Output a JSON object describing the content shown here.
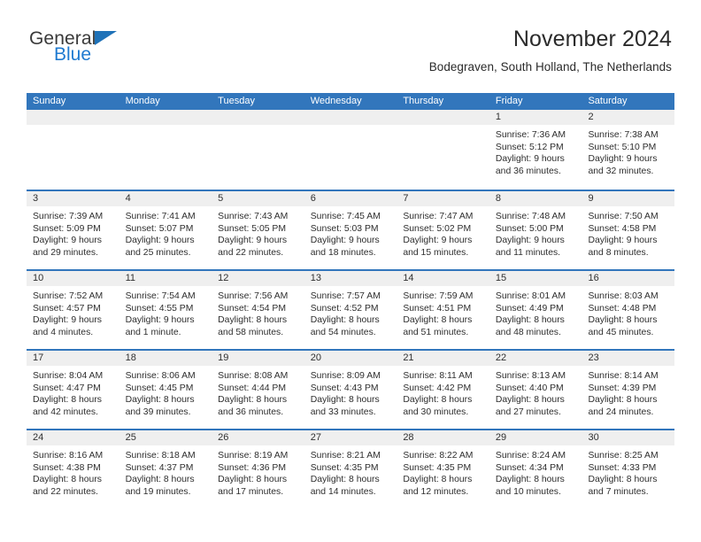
{
  "brand": {
    "name_part1": "General",
    "name_part2": "Blue",
    "triangle_color": "#1f72b8",
    "blue_color": "#1f7ad0"
  },
  "header": {
    "title": "November 2024",
    "subtitle": "Bodegraven, South Holland, The Netherlands"
  },
  "theme": {
    "header_blue": "#3276bc",
    "daynum_band": "#efefef",
    "text": "#2e2e2e"
  },
  "weekdays": [
    "Sunday",
    "Monday",
    "Tuesday",
    "Wednesday",
    "Thursday",
    "Friday",
    "Saturday"
  ],
  "weeks": [
    [
      {
        "day": "",
        "info": ""
      },
      {
        "day": "",
        "info": ""
      },
      {
        "day": "",
        "info": ""
      },
      {
        "day": "",
        "info": ""
      },
      {
        "day": "",
        "info": ""
      },
      {
        "day": "1",
        "info": "Sunrise: 7:36 AM\nSunset: 5:12 PM\nDaylight: 9 hours\nand 36 minutes."
      },
      {
        "day": "2",
        "info": "Sunrise: 7:38 AM\nSunset: 5:10 PM\nDaylight: 9 hours\nand 32 minutes."
      }
    ],
    [
      {
        "day": "3",
        "info": "Sunrise: 7:39 AM\nSunset: 5:09 PM\nDaylight: 9 hours\nand 29 minutes."
      },
      {
        "day": "4",
        "info": "Sunrise: 7:41 AM\nSunset: 5:07 PM\nDaylight: 9 hours\nand 25 minutes."
      },
      {
        "day": "5",
        "info": "Sunrise: 7:43 AM\nSunset: 5:05 PM\nDaylight: 9 hours\nand 22 minutes."
      },
      {
        "day": "6",
        "info": "Sunrise: 7:45 AM\nSunset: 5:03 PM\nDaylight: 9 hours\nand 18 minutes."
      },
      {
        "day": "7",
        "info": "Sunrise: 7:47 AM\nSunset: 5:02 PM\nDaylight: 9 hours\nand 15 minutes."
      },
      {
        "day": "8",
        "info": "Sunrise: 7:48 AM\nSunset: 5:00 PM\nDaylight: 9 hours\nand 11 minutes."
      },
      {
        "day": "9",
        "info": "Sunrise: 7:50 AM\nSunset: 4:58 PM\nDaylight: 9 hours\nand 8 minutes."
      }
    ],
    [
      {
        "day": "10",
        "info": "Sunrise: 7:52 AM\nSunset: 4:57 PM\nDaylight: 9 hours\nand 4 minutes."
      },
      {
        "day": "11",
        "info": "Sunrise: 7:54 AM\nSunset: 4:55 PM\nDaylight: 9 hours\nand 1 minute."
      },
      {
        "day": "12",
        "info": "Sunrise: 7:56 AM\nSunset: 4:54 PM\nDaylight: 8 hours\nand 58 minutes."
      },
      {
        "day": "13",
        "info": "Sunrise: 7:57 AM\nSunset: 4:52 PM\nDaylight: 8 hours\nand 54 minutes."
      },
      {
        "day": "14",
        "info": "Sunrise: 7:59 AM\nSunset: 4:51 PM\nDaylight: 8 hours\nand 51 minutes."
      },
      {
        "day": "15",
        "info": "Sunrise: 8:01 AM\nSunset: 4:49 PM\nDaylight: 8 hours\nand 48 minutes."
      },
      {
        "day": "16",
        "info": "Sunrise: 8:03 AM\nSunset: 4:48 PM\nDaylight: 8 hours\nand 45 minutes."
      }
    ],
    [
      {
        "day": "17",
        "info": "Sunrise: 8:04 AM\nSunset: 4:47 PM\nDaylight: 8 hours\nand 42 minutes."
      },
      {
        "day": "18",
        "info": "Sunrise: 8:06 AM\nSunset: 4:45 PM\nDaylight: 8 hours\nand 39 minutes."
      },
      {
        "day": "19",
        "info": "Sunrise: 8:08 AM\nSunset: 4:44 PM\nDaylight: 8 hours\nand 36 minutes."
      },
      {
        "day": "20",
        "info": "Sunrise: 8:09 AM\nSunset: 4:43 PM\nDaylight: 8 hours\nand 33 minutes."
      },
      {
        "day": "21",
        "info": "Sunrise: 8:11 AM\nSunset: 4:42 PM\nDaylight: 8 hours\nand 30 minutes."
      },
      {
        "day": "22",
        "info": "Sunrise: 8:13 AM\nSunset: 4:40 PM\nDaylight: 8 hours\nand 27 minutes."
      },
      {
        "day": "23",
        "info": "Sunrise: 8:14 AM\nSunset: 4:39 PM\nDaylight: 8 hours\nand 24 minutes."
      }
    ],
    [
      {
        "day": "24",
        "info": "Sunrise: 8:16 AM\nSunset: 4:38 PM\nDaylight: 8 hours\nand 22 minutes."
      },
      {
        "day": "25",
        "info": "Sunrise: 8:18 AM\nSunset: 4:37 PM\nDaylight: 8 hours\nand 19 minutes."
      },
      {
        "day": "26",
        "info": "Sunrise: 8:19 AM\nSunset: 4:36 PM\nDaylight: 8 hours\nand 17 minutes."
      },
      {
        "day": "27",
        "info": "Sunrise: 8:21 AM\nSunset: 4:35 PM\nDaylight: 8 hours\nand 14 minutes."
      },
      {
        "day": "28",
        "info": "Sunrise: 8:22 AM\nSunset: 4:35 PM\nDaylight: 8 hours\nand 12 minutes."
      },
      {
        "day": "29",
        "info": "Sunrise: 8:24 AM\nSunset: 4:34 PM\nDaylight: 8 hours\nand 10 minutes."
      },
      {
        "day": "30",
        "info": "Sunrise: 8:25 AM\nSunset: 4:33 PM\nDaylight: 8 hours\nand 7 minutes."
      }
    ]
  ]
}
